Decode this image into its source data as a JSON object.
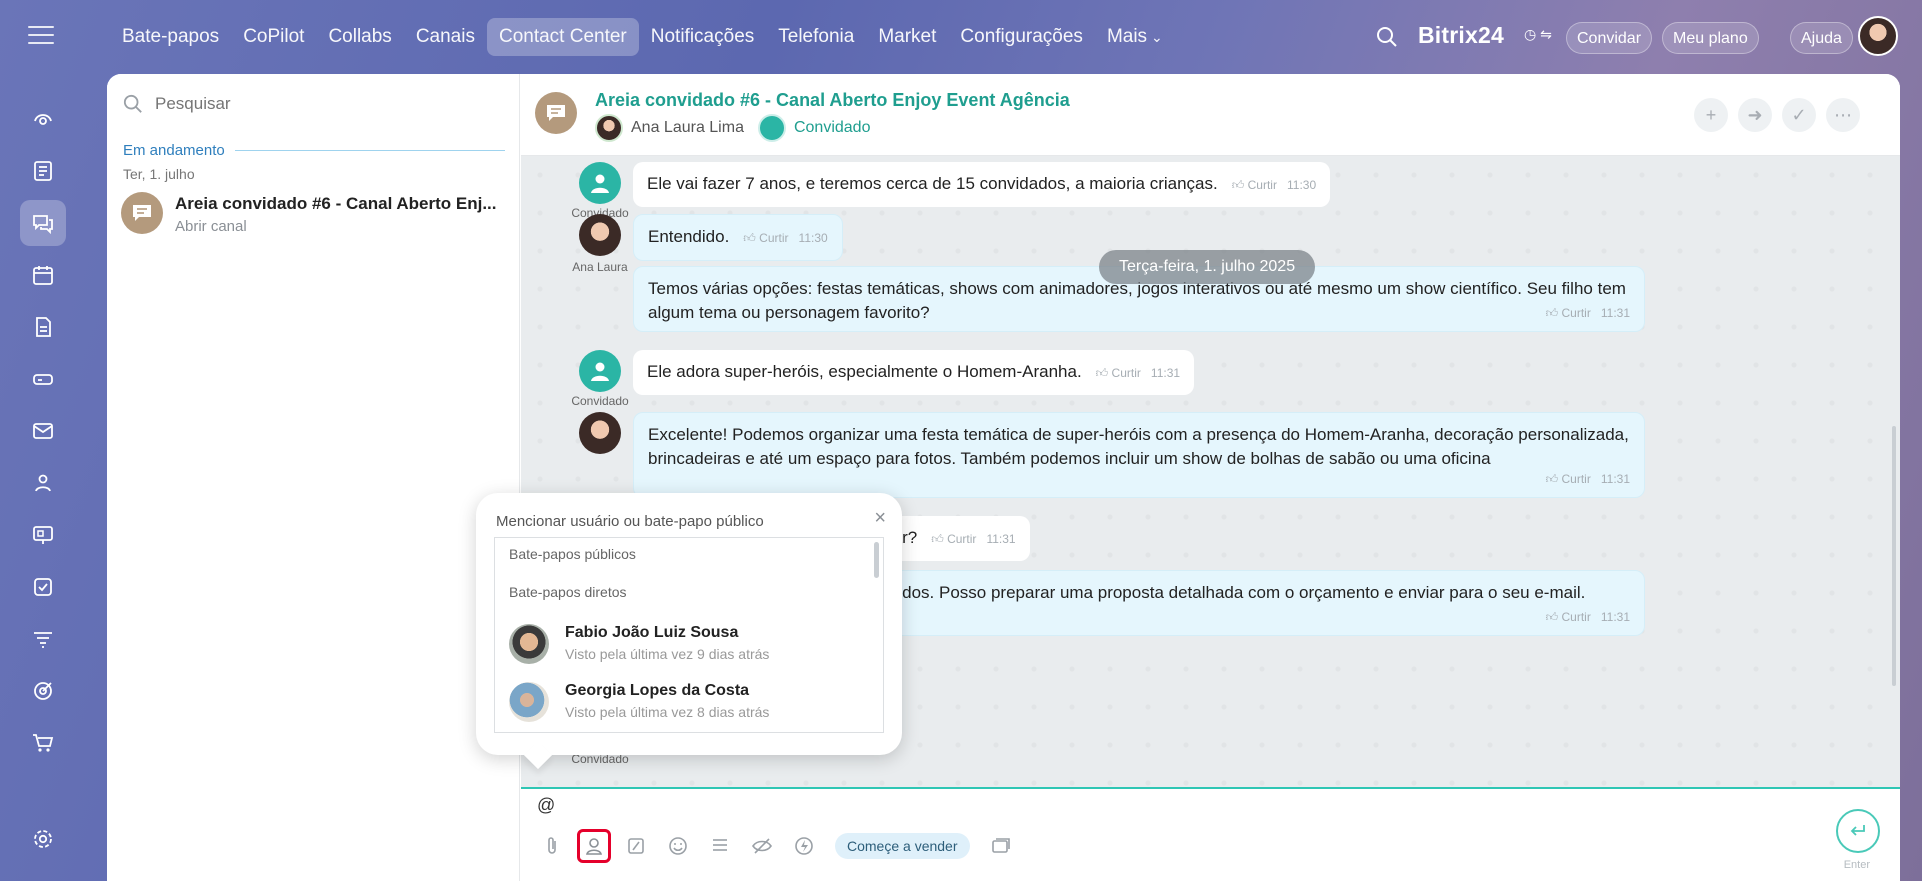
{
  "topbar": {
    "nav": [
      "Bate-papos",
      "CoPilot",
      "Collabs",
      "Canais",
      "Contact Center",
      "Notificações",
      "Telefonia",
      "Market",
      "Configurações",
      "Mais"
    ],
    "active_index": 4,
    "brand": "Bitrix",
    "brand_num": "24",
    "invite": "Convidar",
    "plan": "Meu plano",
    "help": "Ajuda"
  },
  "rail": {
    "icons": [
      "activity-icon",
      "feed-icon",
      "chat-icon",
      "calendar-icon",
      "document-icon",
      "storage-icon",
      "mail-icon",
      "contacts-icon",
      "sites-icon",
      "tasks-icon",
      "filter-icon",
      "target-icon",
      "cart-icon",
      "settings-icon"
    ],
    "active": "chat-icon"
  },
  "list": {
    "search_placeholder": "Pesquisar",
    "section": "Em andamento",
    "date": "Ter, 1. julho",
    "chat_title": "Areia convidado #6 - Canal Aberto Enjoy Event Agência",
    "chat_title_display": "Areia convidado #6 - Canal Aberto Enj...",
    "chat_sub": "Abrir canal"
  },
  "chat": {
    "title": "Areia convidado #6 - Canal Aberto Enjoy Event Agência",
    "user1": "Ana Laura Lima",
    "user2": "Convidado",
    "date_chip": "Terça-feira, 1. julho 2025",
    "like": "Curtir",
    "messages": [
      {
        "text": "Ele vai fazer 7 anos, e teremos cerca de 15 convidados, a maioria crianças.",
        "time": "11:30",
        "author": "Convidado"
      },
      {
        "text": "Entendido.",
        "time": "11:30",
        "author": "Ana Laura"
      },
      {
        "text": "Temos várias opções: festas temáticas, shows com animadores, jogos interativos ou até mesmo um show científico. Seu filho tem algum tema ou personagem favorito?",
        "time": "11:31"
      },
      {
        "text": "Ele adora super-heróis, especialmente o Homem-Aranha.",
        "time": "11:31",
        "author": "Convidado"
      },
      {
        "text": "Excelente! Podemos organizar uma festa temática de super-heróis com a presença do Homem-Aranha, decoração personalizada, brincadeiras e até um espaço para fotos. Também podemos incluir um show de bolhas de sabão ou uma oficina",
        "time": "11:31"
      },
      {
        "text": "vai custar?",
        "time": "11:31"
      },
      {
        "text": "s escolhidos. Posso preparar uma proposta detalhada com o orçamento e enviar para o seu e-mail.",
        "time": "11:31"
      }
    ],
    "last_author": "Convidado"
  },
  "composer": {
    "value": "@",
    "sell": "Começe a vender",
    "enter": "Enter"
  },
  "popup": {
    "title": "Mencionar usuário ou bate-papo público",
    "group_public": "Bate-papos públicos",
    "group_direct": "Bate-papos diretos",
    "users": [
      {
        "name": "Fabio João Luiz Sousa",
        "seen": "Visto pela última vez 9 dias atrás"
      },
      {
        "name": "Georgia Lopes da Costa",
        "seen": "Visto pela última vez 8 dias atrás"
      }
    ]
  },
  "colors": {
    "accent": "#1f9e8f",
    "highlight": "#e5002b"
  }
}
